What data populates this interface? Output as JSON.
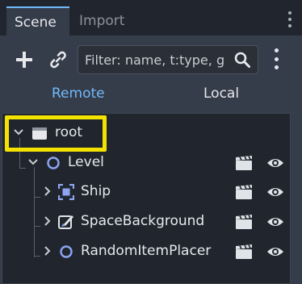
{
  "tabs": [
    {
      "label": "Scene",
      "active": true
    },
    {
      "label": "Import",
      "active": false
    }
  ],
  "toolbar": {
    "add_icon": "plus-icon",
    "link_icon": "chain-link-icon",
    "filter_placeholder": "Filter: name, t:type, g",
    "filter_value": "",
    "search_icon": "magnifier-icon",
    "menu_icon": "kebab-menu-icon"
  },
  "modes": {
    "remote": "Remote",
    "local": "Local",
    "active": "Remote"
  },
  "tree": [
    {
      "label": "root",
      "icon": "folder-node-icon",
      "expanded": true
    },
    {
      "label": "Level",
      "icon": "node2d-circle-icon",
      "expanded": true
    },
    {
      "label": "Ship",
      "icon": "area2d-icon",
      "expanded": false
    },
    {
      "label": "SpaceBackground",
      "icon": "sprite-brush-icon",
      "expanded": false
    },
    {
      "label": "RandomItemPlacer",
      "icon": "node2d-circle-icon",
      "expanded": false
    }
  ],
  "colors": {
    "accent": "#70bafa",
    "highlight": "#f4e200",
    "panel": "#363d4a",
    "tree_bg": "#21262e"
  }
}
